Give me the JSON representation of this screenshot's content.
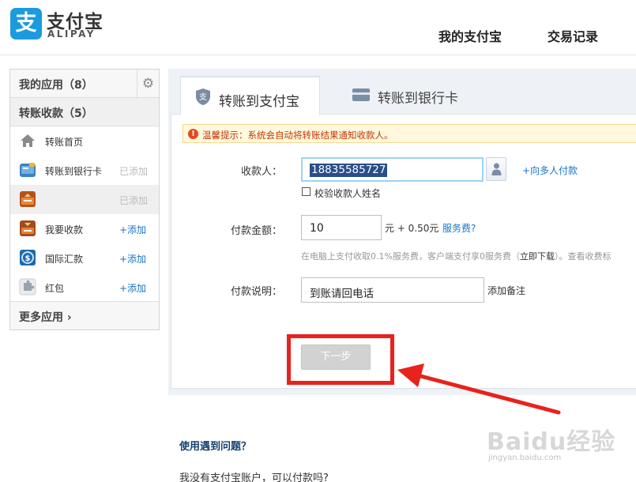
{
  "header": {
    "logo_glyph": "支",
    "logo_cn": "支付宝",
    "logo_en": "ALIPAY",
    "nav": [
      "我的支付宝",
      "交易记录"
    ]
  },
  "sidebar": {
    "my_apps": "我的应用（8）",
    "transfer_section": "转账收款（5）",
    "items": [
      {
        "label": "转账首页",
        "action": "",
        "icon": "home-icon"
      },
      {
        "label": "转账到银行卡",
        "action": "已添加",
        "icon": "bank-card-app-icon"
      },
      {
        "label": "",
        "action": "已添加",
        "icon": "transfer-app-icon"
      },
      {
        "label": "我要收款",
        "action": "+添加",
        "icon": "receive-money-icon"
      },
      {
        "label": "国际汇款",
        "action": "+添加",
        "icon": "international-remit-icon"
      },
      {
        "label": "红包",
        "action": "+添加",
        "icon": "puzzle-icon"
      }
    ],
    "more": "更多应用"
  },
  "tabs": {
    "active": "转账到支付宝",
    "other": "转账到银行卡"
  },
  "notice": {
    "icon": "!",
    "text": "温馨提示：系统会自动将转账结果通知收款人。"
  },
  "form": {
    "recipient_label": "收款人：",
    "recipient_value": "18835585727",
    "multi_link": "+向多人付款",
    "verify_name": "校验收款人姓名",
    "amount_label": "付款金额：",
    "amount_value": "10",
    "amount_unit": "元 + 0.50元",
    "fee_link": "服务费?",
    "fee_note_a": "在电脑上支付收取0.1%服务费，客户端支付享0服务费（",
    "fee_note_b": "立即下载",
    "fee_note_c": "）。查看收费标",
    "memo_label": "付款说明：",
    "memo_value": "到账请回电话",
    "memo_add": "添加备注",
    "next_button": "下一步"
  },
  "help": {
    "title": "使用遇到问题？",
    "question": "我没有支付宝账户，可以付款吗?"
  },
  "watermark": {
    "main": "Baidu经验",
    "sub": "jingyan.baidu.com"
  },
  "colors": {
    "brand_blue": "#1b9bde",
    "link_blue": "#1775c9",
    "highlight_red": "#e8221c",
    "notice_text": "#c2380a"
  }
}
